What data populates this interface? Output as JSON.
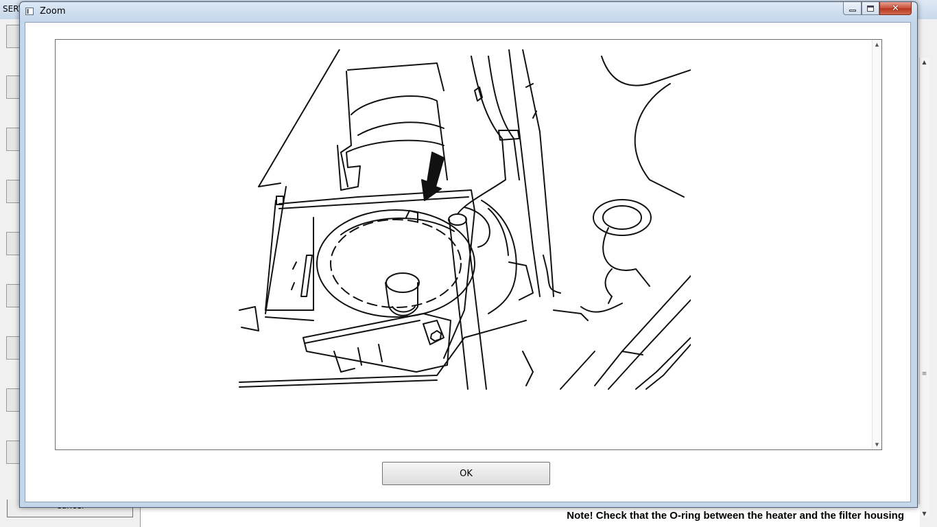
{
  "background_window": {
    "title": "SERV",
    "cancel_label": "Cancel",
    "note_text": "Note! Check that the O-ring between the heater and the filter housing"
  },
  "dialog": {
    "title": "Zoom",
    "ok_label": "OK",
    "illustration_icon": "fuel-filter-heater-illustration",
    "caption_icons": [
      "minimize-icon",
      "maximize-icon",
      "close-icon"
    ],
    "colors": {
      "title_gradient_top": "#dce8f5",
      "close_button": "#c7503a"
    }
  }
}
